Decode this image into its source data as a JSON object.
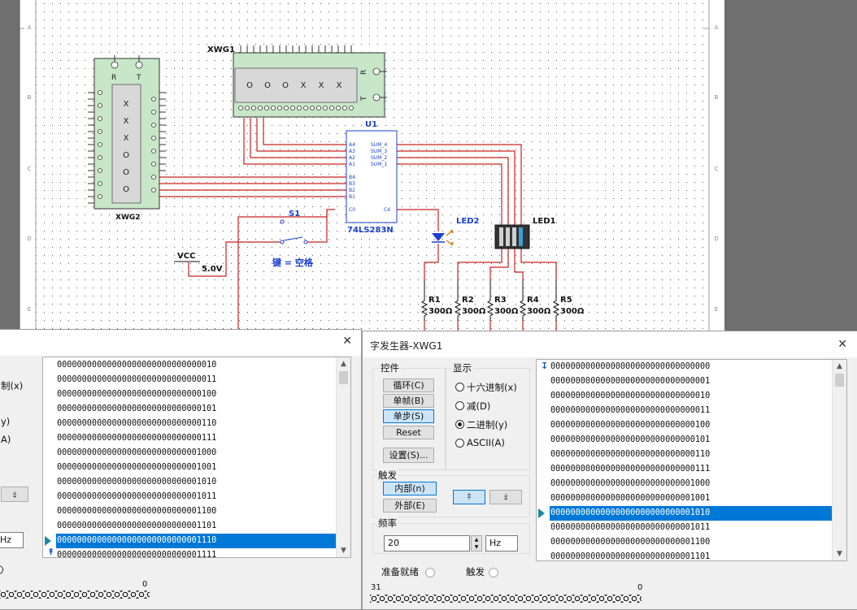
{
  "schematic": {
    "xwg1_label": "XWG1",
    "xwg1_display": [
      "O",
      "O",
      "O",
      "X",
      "X",
      "X"
    ],
    "xwg1_r": "R",
    "xwg1_t": "T",
    "xwg2_label": "XWG2",
    "xwg2_display": [
      "X",
      "X",
      "X",
      "O",
      "O",
      "O"
    ],
    "xwg2_r": "R",
    "xwg2_t": "T",
    "u1_label": "U1",
    "u1_part": "74LS283N",
    "u1_left_pins": [
      "A4",
      "A3",
      "A2",
      "A1",
      "B4",
      "B3",
      "B2",
      "B1",
      "C0"
    ],
    "u1_right_pins": [
      "SUM_4",
      "SUM_3",
      "SUM_2",
      "SUM_1",
      "C4"
    ],
    "s1_label": "S1",
    "key_label": "键 = 空格",
    "vcc_label": "VCC",
    "vcc_value": "5.0V",
    "led2_label": "LED2",
    "led1_label": "LED1",
    "resistors": [
      {
        "name": "R1",
        "value": "300Ω"
      },
      {
        "name": "R2",
        "value": "300Ω"
      },
      {
        "name": "R3",
        "value": "300Ω"
      },
      {
        "name": "R4",
        "value": "300Ω"
      },
      {
        "name": "R5",
        "value": "300Ω"
      }
    ],
    "border_marks": [
      "A",
      "B",
      "C",
      "D",
      "E"
    ]
  },
  "left_dialog": {
    "partial_labels": [
      "制(x)",
      "y)",
      "A)"
    ],
    "freq_unit": "Hz",
    "bit_low": "0",
    "rows": [
      "00000000000000000000000000000010",
      "00000000000000000000000000000011",
      "00000000000000000000000000000100",
      "00000000000000000000000000000101",
      "00000000000000000000000000000110",
      "00000000000000000000000000000111",
      "00000000000000000000000000001000",
      "00000000000000000000000000001001",
      "00000000000000000000000000001010",
      "00000000000000000000000000001011",
      "00000000000000000000000000001100",
      "00000000000000000000000000001101",
      "00000000000000000000000000001110",
      "00000000000000000000000000001111"
    ],
    "selected_index": 12
  },
  "right_dialog": {
    "title": "字发生器-XWG1",
    "controls_group": "控件",
    "btn_cycle": "循环(C)",
    "btn_burst": "单帧(B)",
    "btn_step": "单步(S)",
    "btn_reset": "Reset",
    "btn_settings": "设置(S)...",
    "display_group": "显示",
    "radio_hex": "十六进制(x)",
    "radio_dec": "减(D)",
    "radio_bin": "二进制(y)",
    "radio_ascii": "ASCII(A)",
    "trigger_group": "触发",
    "btn_internal": "内部(n)",
    "btn_external": "外部(E)",
    "freq_group": "频率",
    "freq_value": "20",
    "freq_unit": "Hz",
    "ready_label": "准备就绪",
    "trigger_label": "触发",
    "bit_high": "31",
    "bit_low": "0",
    "rows": [
      "00000000000000000000000000000000",
      "00000000000000000000000000000001",
      "00000000000000000000000000000010",
      "00000000000000000000000000000011",
      "00000000000000000000000000000100",
      "00000000000000000000000000000101",
      "00000000000000000000000000000110",
      "00000000000000000000000000000111",
      "00000000000000000000000000001000",
      "00000000000000000000000000001001",
      "00000000000000000000000000001010",
      "00000000000000000000000000001011",
      "00000000000000000000000000001100",
      "00000000000000000000000000001101"
    ],
    "selected_index": 10
  },
  "colors": {
    "wire": "#cc2020",
    "accent": "#0078d7",
    "part": "#c8e6c8",
    "label_blue": "#1a3fd1"
  }
}
